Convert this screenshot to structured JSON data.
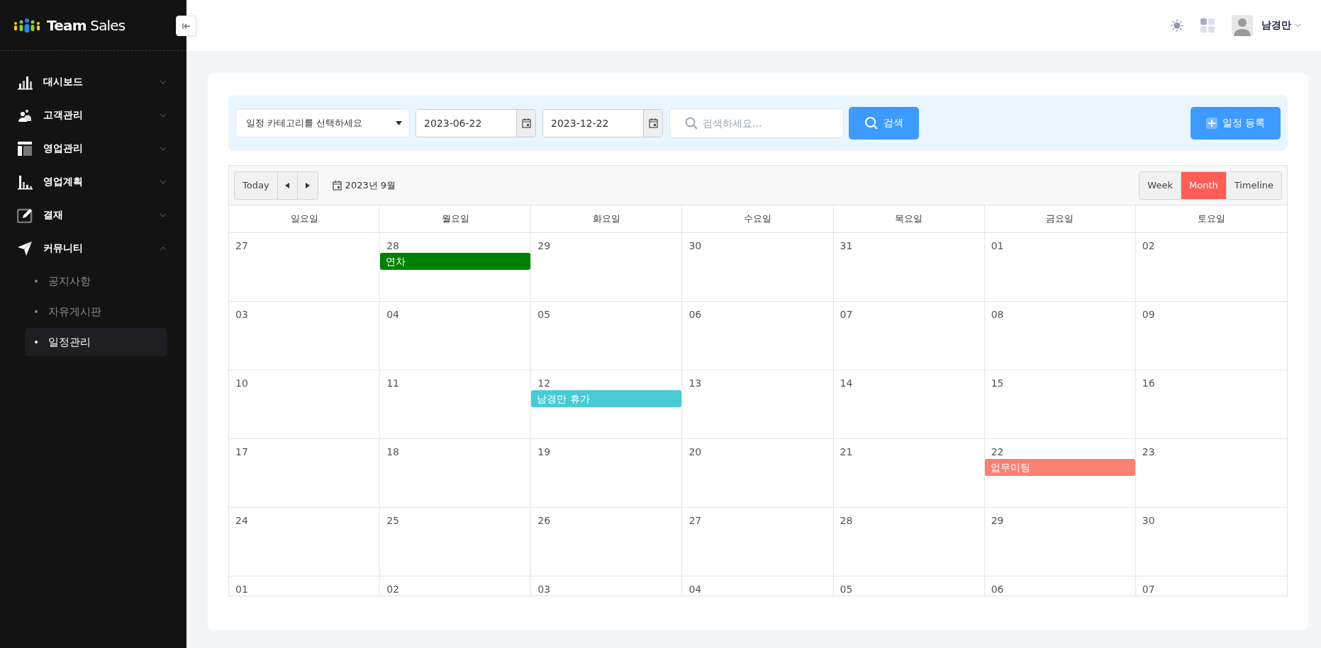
{
  "brand": {
    "name_bold": "Team",
    "name_light": "Sales"
  },
  "sidebar": {
    "items": [
      {
        "label": "대시보드",
        "expanded": false
      },
      {
        "label": "고객관리",
        "expanded": false
      },
      {
        "label": "영업관리",
        "expanded": false
      },
      {
        "label": "영업계획",
        "expanded": false
      },
      {
        "label": "결재",
        "expanded": false
      },
      {
        "label": "커뮤니티",
        "expanded": true,
        "children": [
          {
            "label": "공지사항",
            "selected": false
          },
          {
            "label": "자유게시판",
            "selected": false
          },
          {
            "label": "일정관리",
            "selected": true
          }
        ]
      }
    ]
  },
  "user": {
    "name": "남경만"
  },
  "filters": {
    "category": {
      "placeholder": "일정 카테고리를 선택하세요"
    },
    "date_from": "2023-06-22",
    "date_to": "2023-12-22",
    "search": {
      "placeholder": "검색하세요..."
    },
    "search_button": "검색",
    "add_button": "일정 등록"
  },
  "calendar": {
    "today_button": "Today",
    "title": "2023년 9월",
    "views": [
      {
        "label": "Week",
        "selected": false
      },
      {
        "label": "Month",
        "selected": true
      },
      {
        "label": "Timeline",
        "selected": false
      }
    ],
    "weekdays": [
      "일요일",
      "월요일",
      "화요일",
      "수요일",
      "목요일",
      "금요일",
      "토요일"
    ],
    "weeks": [
      {
        "days": [
          {
            "label": "27"
          },
          {
            "label": "28",
            "events": [
              {
                "title": "연차",
                "color": "#008000"
              }
            ]
          },
          {
            "label": "29"
          },
          {
            "label": "30"
          },
          {
            "label": "31"
          },
          {
            "label": "01"
          },
          {
            "label": "02"
          }
        ]
      },
      {
        "days": [
          {
            "label": "03"
          },
          {
            "label": "04"
          },
          {
            "label": "05"
          },
          {
            "label": "06"
          },
          {
            "label": "07"
          },
          {
            "label": "08"
          },
          {
            "label": "09"
          }
        ]
      },
      {
        "days": [
          {
            "label": "10"
          },
          {
            "label": "11"
          },
          {
            "label": "12",
            "events": [
              {
                "title": "남경만 휴가",
                "color": "#48cbd6"
              }
            ]
          },
          {
            "label": "13"
          },
          {
            "label": "14"
          },
          {
            "label": "15"
          },
          {
            "label": "16"
          }
        ]
      },
      {
        "days": [
          {
            "label": "17"
          },
          {
            "label": "18"
          },
          {
            "label": "19"
          },
          {
            "label": "20"
          },
          {
            "label": "21"
          },
          {
            "label": "22",
            "events": [
              {
                "title": "업무미팅",
                "color": "#fa8072"
              }
            ]
          },
          {
            "label": "23"
          }
        ]
      },
      {
        "days": [
          {
            "label": "24"
          },
          {
            "label": "25"
          },
          {
            "label": "26"
          },
          {
            "label": "27"
          },
          {
            "label": "28"
          },
          {
            "label": "29"
          },
          {
            "label": "30"
          }
        ]
      },
      {
        "days": [
          {
            "label": "01"
          },
          {
            "label": "02"
          },
          {
            "label": "03"
          },
          {
            "label": "04"
          },
          {
            "label": "05"
          },
          {
            "label": "06"
          },
          {
            "label": "07"
          }
        ]
      }
    ]
  }
}
